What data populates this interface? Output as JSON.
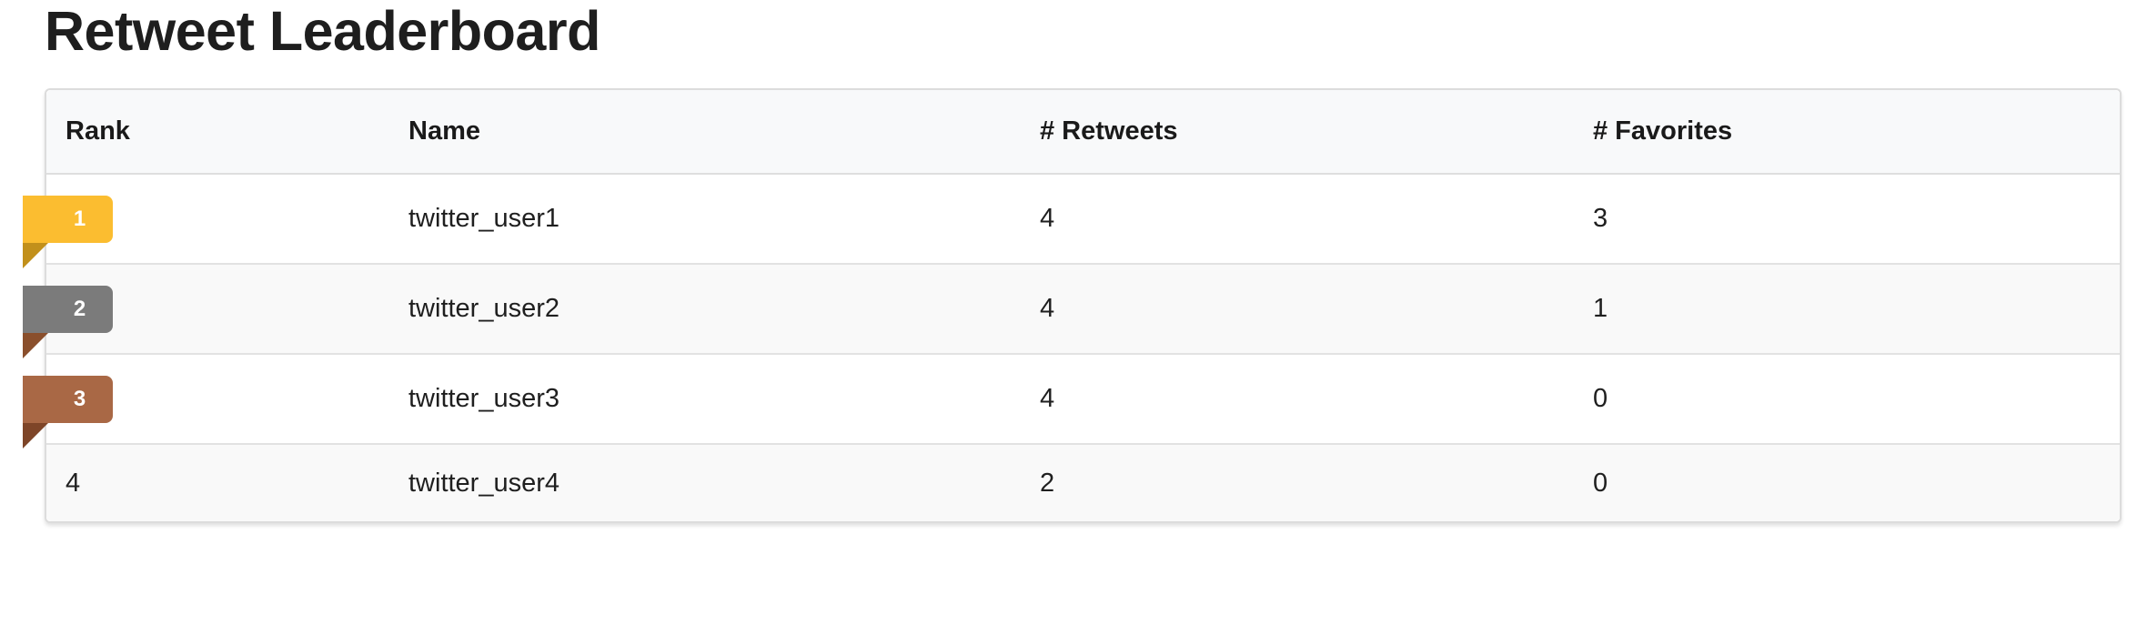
{
  "page": {
    "title": "Retweet Leaderboard"
  },
  "table": {
    "columns": [
      "Rank",
      "Name",
      "# Retweets",
      "# Favorites"
    ],
    "rows": [
      {
        "rank": "1",
        "name": "twitter_user1",
        "retweets": "4",
        "favorites": "3"
      },
      {
        "rank": "2",
        "name": "twitter_user2",
        "retweets": "4",
        "favorites": "1"
      },
      {
        "rank": "3",
        "name": "twitter_user3",
        "retweets": "4",
        "favorites": "0"
      },
      {
        "rank": "4",
        "name": "twitter_user4",
        "retweets": "2",
        "favorites": "0"
      }
    ]
  },
  "colors": {
    "gold": "#fbbd30",
    "silver": "#7b7b7b",
    "bronze": "#a96845"
  }
}
